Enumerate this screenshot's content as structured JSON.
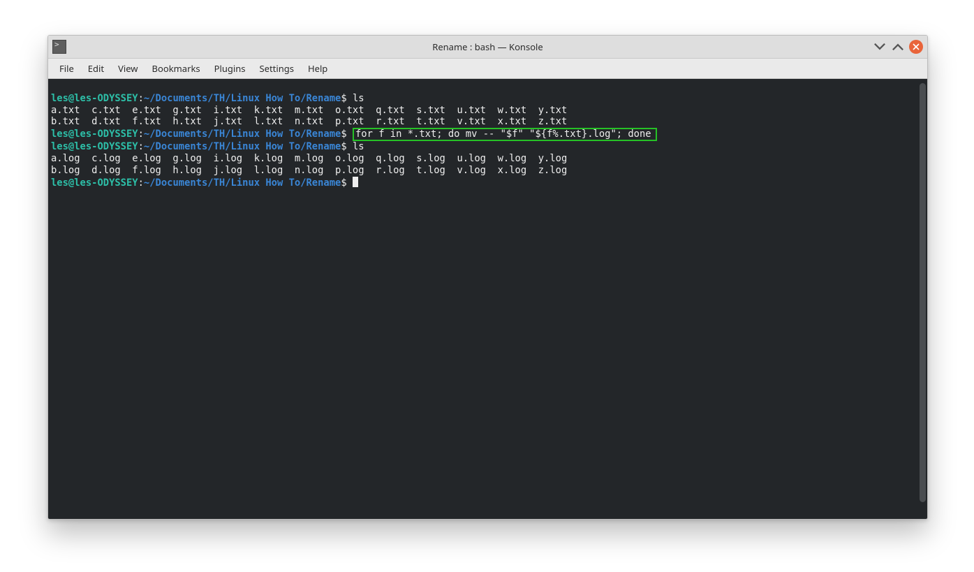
{
  "titlebar": {
    "title": "Rename : bash — Konsole"
  },
  "menu": {
    "file": "File",
    "edit": "Edit",
    "view": "View",
    "bookmarks": "Bookmarks",
    "plugins": "Plugins",
    "settings": "Settings",
    "help": "Help"
  },
  "prompt": {
    "userhost": "les@les-ODYSSEY",
    "sep": ":",
    "path": "~/Documents/TH/Linux How To/Rename",
    "dollar": "$"
  },
  "lines": {
    "cmd1": "ls",
    "out_txt_row1": "a.txt  c.txt  e.txt  g.txt  i.txt  k.txt  m.txt  o.txt  q.txt  s.txt  u.txt  w.txt  y.txt",
    "out_txt_row2": "b.txt  d.txt  f.txt  h.txt  j.txt  l.txt  n.txt  p.txt  r.txt  t.txt  v.txt  x.txt  z.txt",
    "cmd2": "for f in *.txt; do mv -- \"$f\" \"${f%.txt}.log\"; done",
    "cmd3": "ls",
    "out_log_row1": "a.log  c.log  e.log  g.log  i.log  k.log  m.log  o.log  q.log  s.log  u.log  w.log  y.log",
    "out_log_row2": "b.log  d.log  f.log  h.log  j.log  l.log  n.log  p.log  r.log  t.log  v.log  x.log  z.log"
  }
}
